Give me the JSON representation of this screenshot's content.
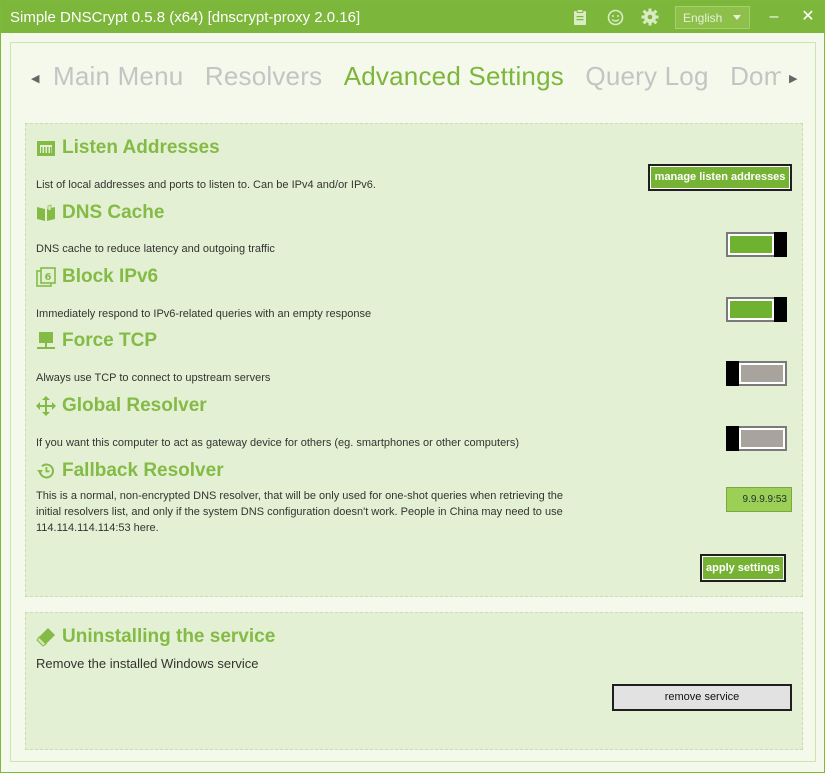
{
  "window": {
    "title": "Simple DNSCrypt 0.5.8 (x64) [dnscrypt-proxy 2.0.16]",
    "language": "English",
    "minimize": "–",
    "close": "✕"
  },
  "tabs": [
    "Main Menu",
    "Resolvers",
    "Advanced Settings",
    "Query Log",
    "Doma"
  ],
  "active_tab": "Advanced Settings",
  "settings": {
    "listen": {
      "title": "Listen Addresses",
      "description": "List of local addresses and ports to listen to. Can be IPv4 and/or IPv6.",
      "button": "manage listen addresses",
      "icon": "ethernet-port-icon"
    },
    "cache": {
      "title": "DNS Cache",
      "description": "DNS cache to reduce latency and outgoing traffic",
      "enabled": true,
      "icon": "book-icon"
    },
    "ipv6": {
      "title": "Block IPv6",
      "description": "Immediately respond to IPv6-related queries with an empty response",
      "enabled": true,
      "icon": "six-box-icon"
    },
    "tcp": {
      "title": "Force TCP",
      "description": "Always use TCP to connect to upstream servers",
      "enabled": false,
      "icon": "network-icon"
    },
    "global": {
      "title": "Global Resolver",
      "description": "If you want this computer to act as gateway device for others (eg. smartphones or other computers)",
      "enabled": false,
      "icon": "arrows-move-icon"
    },
    "fallback": {
      "title": "Fallback Resolver",
      "description": "This is a normal, non-encrypted DNS resolver, that will be only used for one-shot queries when retrieving the initial resolvers list, and only if the system DNS configuration doesn't work. People in China may need to use 114.114.114.114:53 here.",
      "value": "9.9.9.9:53",
      "icon": "restore-icon"
    },
    "apply_button": "apply settings"
  },
  "uninstall": {
    "title": "Uninstalling the service",
    "description": "Remove the installed Windows service",
    "button": "remove service",
    "icon": "eraser-icon"
  },
  "colors": {
    "accent": "#7cb63b",
    "title_text": "#84bb46",
    "panel": "#e4f0d3",
    "toggle_on": "#6fb22f",
    "toggle_off": "#a8a39c"
  }
}
